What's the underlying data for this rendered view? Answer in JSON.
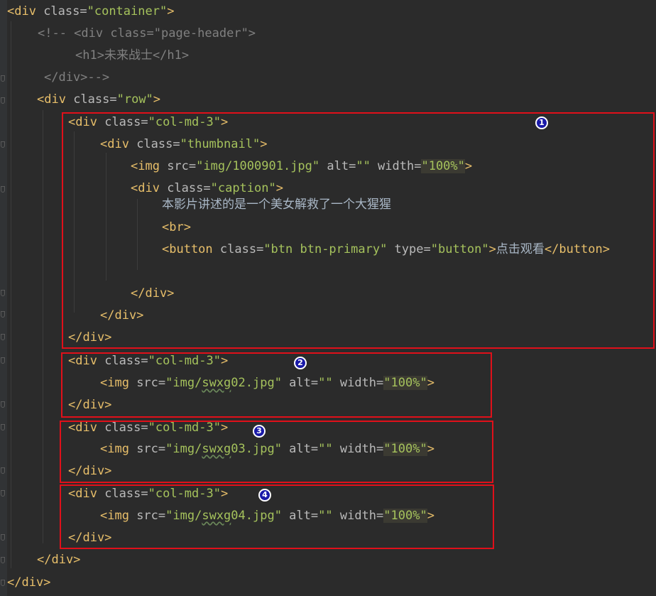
{
  "colors": {
    "background": "#2b2b2b",
    "tag": "#e8bf6a",
    "attribute": "#bababa",
    "string": "#a5c25c",
    "comment": "#808080",
    "highlight_box": "#e0101a",
    "badge": "#1a1aa8"
  },
  "lines": [
    {
      "t": "<div",
      "a": " class=",
      "v": "\"container\"",
      "e": ">"
    },
    {
      "c": "<!-- <div class=\"page-header\">"
    },
    {
      "c": "<h1>未来战士</h1>"
    },
    {
      "c": "</div>-->"
    },
    {
      "t": "<div",
      "a": " class=",
      "v": "\"row\"",
      "e": ">"
    },
    {
      "t": "<div",
      "a": " class=",
      "v": "\"col-md-3\"",
      "e": ">"
    },
    {
      "t": "<div",
      "a": " class=",
      "v": "\"thumbnail\"",
      "e": ">"
    },
    {
      "t": "<img",
      "a1": " src=",
      "v1": "\"img/1000901.jpg\"",
      "a2": " alt=",
      "v2": "\"\"",
      "a3": " width=",
      "v3": "\"100%\"",
      "e": ">"
    },
    {
      "t": "<div",
      "a": " class=",
      "v": "\"caption\"",
      "e": ">"
    },
    {
      "text": "本影片讲述的是一个美女解救了一个大猩猩"
    },
    {
      "t": "<br>"
    },
    {
      "t": "<button",
      "a1": " class=",
      "v1": "\"btn btn-primary\"",
      "a2": " type=",
      "v2": "\"button\"",
      "e": ">",
      "text": "点击观看",
      "close": "</button>"
    },
    {
      "blank": ""
    },
    {
      "t": "</div>"
    },
    {
      "t": "</div>"
    },
    {
      "t": "</div>"
    },
    {
      "t": "<div",
      "a": " class=",
      "v": "\"col-md-3\"",
      "e": ">"
    },
    {
      "t": "<img",
      "a1": " src=",
      "v1a": "\"img/",
      "v1b": "swxg",
      "v1c": "02.jpg\"",
      "a2": " alt=",
      "v2": "\"\"",
      "a3": " width=",
      "v3": "\"100%\"",
      "e": ">"
    },
    {
      "t": "</div>"
    },
    {
      "t": "<div",
      "a": " class=",
      "v": "\"col-md-3\"",
      "e": ">"
    },
    {
      "t": "<img",
      "a1": " src=",
      "v1a": "\"img/",
      "v1b": "swxg",
      "v1c": "03.jpg\"",
      "a2": " alt=",
      "v2": "\"\"",
      "a3": " width=",
      "v3": "\"100%\"",
      "e": ">"
    },
    {
      "t": "</div>"
    },
    {
      "t": "<div",
      "a": " class=",
      "v": "\"col-md-3\"",
      "e": ">"
    },
    {
      "t": "<img",
      "a1": " src=",
      "v1a": "\"img/",
      "v1b": "swxg",
      "v1c": "04.jpg\"",
      "a2": " alt=",
      "v2": "\"\"",
      "a3": " width=",
      "v3": "\"100%\"",
      "e": ">"
    },
    {
      "t": "</div>"
    },
    {
      "t": "</div>"
    },
    {
      "t": "</div>"
    }
  ],
  "badges": [
    "1",
    "2",
    "3",
    "4"
  ]
}
